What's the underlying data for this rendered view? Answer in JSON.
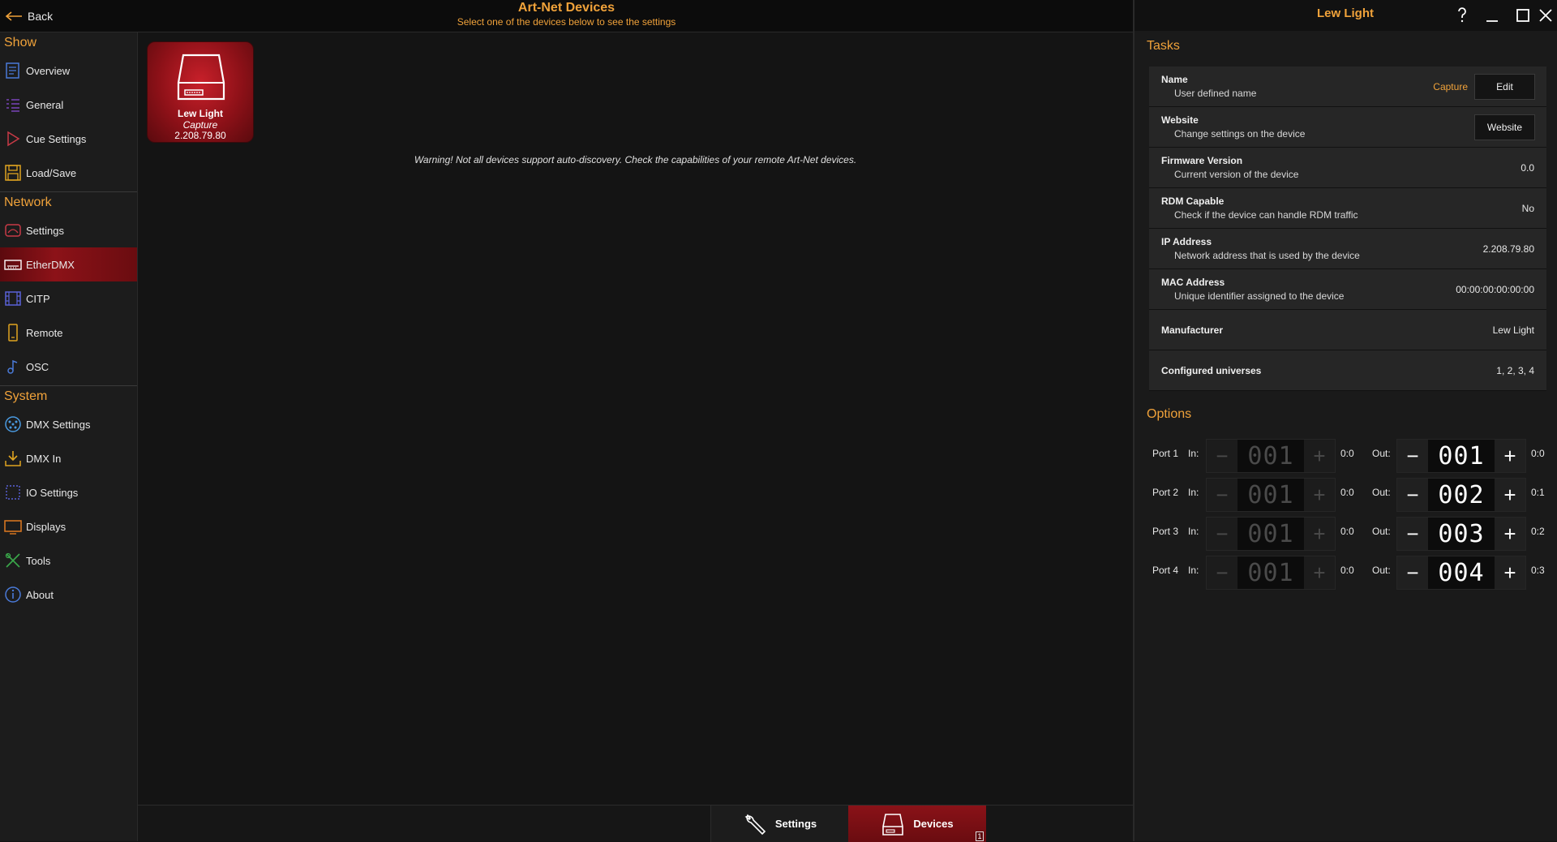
{
  "header": {
    "back_label": "Back",
    "title": "Art-Net Devices",
    "subtitle": "Select one of the devices below to see the settings"
  },
  "sidebar": {
    "sections": [
      {
        "title": "Show",
        "items": [
          {
            "label": "Overview",
            "icon": "overview-icon"
          },
          {
            "label": "General",
            "icon": "general-icon"
          },
          {
            "label": "Cue Settings",
            "icon": "cue-settings-icon"
          },
          {
            "label": "Load/Save",
            "icon": "load-save-icon"
          }
        ]
      },
      {
        "title": "Network",
        "items": [
          {
            "label": "Settings",
            "icon": "network-settings-icon"
          },
          {
            "label": "EtherDMX",
            "icon": "etherdmx-icon",
            "active": true
          },
          {
            "label": "CITP",
            "icon": "citp-icon"
          },
          {
            "label": "Remote",
            "icon": "remote-icon"
          },
          {
            "label": "OSC",
            "icon": "osc-icon"
          }
        ]
      },
      {
        "title": "System",
        "items": [
          {
            "label": "DMX Settings",
            "icon": "dmx-settings-icon"
          },
          {
            "label": "DMX In",
            "icon": "dmx-in-icon"
          },
          {
            "label": "IO Settings",
            "icon": "io-settings-icon"
          },
          {
            "label": "Displays",
            "icon": "displays-icon"
          },
          {
            "label": "Tools",
            "icon": "tools-icon"
          },
          {
            "label": "About",
            "icon": "about-icon"
          }
        ]
      }
    ]
  },
  "device": {
    "name": "Lew Light",
    "mode": "Capture",
    "ip": "2.208.79.80"
  },
  "warning": "Warning! Not all devices support auto-discovery. Check the capabilities of your remote Art-Net devices.",
  "bottom_tabs": {
    "settings_label": "Settings",
    "devices_label": "Devices",
    "devices_count": "1"
  },
  "panel": {
    "title": "Lew Light",
    "window_buttons": [
      "help-icon",
      "minimize-icon",
      "maximize-icon",
      "close-icon"
    ],
    "tasks_title": "Tasks",
    "tasks": [
      {
        "name": "Name",
        "desc": "User defined name",
        "value": "Capture",
        "button": "Edit"
      },
      {
        "name": "Website",
        "desc": "Change settings on the device",
        "button": "Website"
      },
      {
        "name": "Firmware Version",
        "desc": "Current version of the device",
        "value": "0.0"
      },
      {
        "name": "RDM Capable",
        "desc": "Check if the device can handle RDM traffic",
        "value": "No"
      },
      {
        "name": "IP Address",
        "desc": "Network address that is used by the device",
        "value": "2.208.79.80"
      },
      {
        "name": "MAC Address",
        "desc": "Unique identifier assigned to the device",
        "value": "00:00:00:00:00:00"
      },
      {
        "name": "Manufacturer",
        "value": "Lew Light"
      },
      {
        "name": "Configured universes",
        "value": "1, 2, 3, 4"
      }
    ],
    "options_title": "Options",
    "in_label": "In:",
    "out_label": "Out:",
    "ports": [
      {
        "label": "Port 1",
        "in_value": "001",
        "in_addr": "0:0",
        "out_value": "001",
        "out_addr": "0:0"
      },
      {
        "label": "Port 2",
        "in_value": "001",
        "in_addr": "0:0",
        "out_value": "002",
        "out_addr": "0:1"
      },
      {
        "label": "Port 3",
        "in_value": "001",
        "in_addr": "0:0",
        "out_value": "003",
        "out_addr": "0:2"
      },
      {
        "label": "Port 4",
        "in_value": "001",
        "in_addr": "0:0",
        "out_value": "004",
        "out_addr": "0:3"
      }
    ]
  },
  "colors": {
    "accent": "#f0a23a",
    "active": "#8c1218",
    "background": "#141414"
  }
}
